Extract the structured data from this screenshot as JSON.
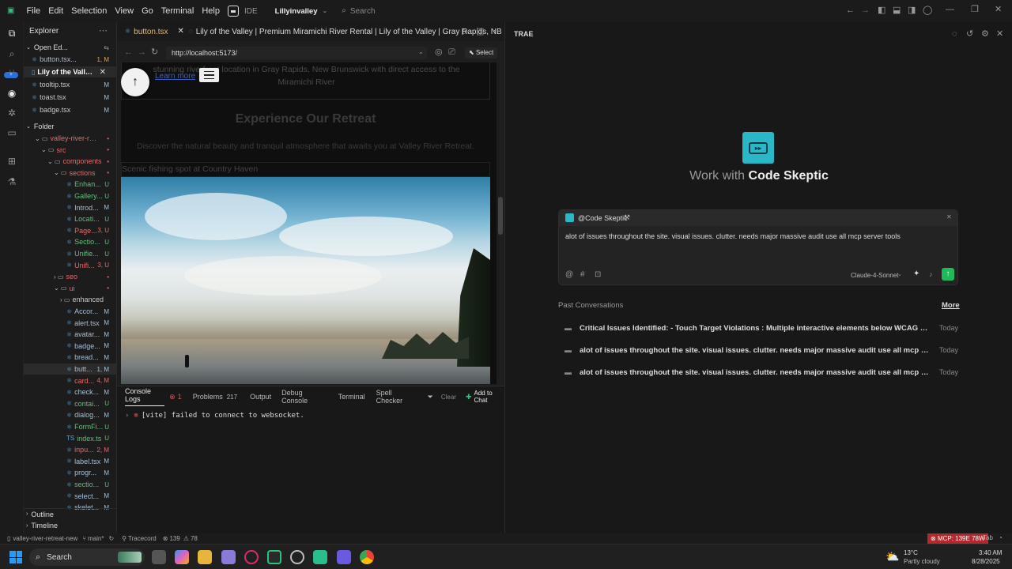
{
  "menu": [
    "File",
    "Edit",
    "Selection",
    "View",
    "Go",
    "Terminal",
    "Help"
  ],
  "ide_badge": "IDE",
  "workspace": "Lillyinvalley",
  "search_placeholder": "Search",
  "explorer": {
    "title": "Explorer",
    "open_editors_label": "Open Ed...",
    "open_editors": [
      {
        "name": "button.tsx...",
        "status": "1, M"
      },
      {
        "name": "Lily of the Valley...",
        "status": ""
      },
      {
        "name": "tooltip.tsx",
        "status": "M"
      },
      {
        "name": "toast.tsx",
        "status": "M"
      },
      {
        "name": "badge.tsx",
        "status": "M"
      }
    ],
    "folder_label": "Folder",
    "tree": [
      {
        "name": "valley-river-retr...",
        "status": "•"
      },
      {
        "name": "src",
        "status": "•"
      },
      {
        "name": "components",
        "status": "•"
      },
      {
        "name": "sections",
        "status": "•"
      },
      {
        "name": "Enhan...",
        "status": "U"
      },
      {
        "name": "Gallery...",
        "status": "U"
      },
      {
        "name": "Introd...",
        "status": "M"
      },
      {
        "name": "Locati...",
        "status": "U"
      },
      {
        "name": "Page...",
        "status": "3, U"
      },
      {
        "name": "Sectio...",
        "status": "U"
      },
      {
        "name": "Unifie...",
        "status": "U"
      },
      {
        "name": "Unifi...",
        "status": "3, U"
      },
      {
        "name": "seo",
        "status": "•"
      },
      {
        "name": "ui",
        "status": "•"
      },
      {
        "name": "enhanced",
        "status": ""
      },
      {
        "name": "Accor...",
        "status": "M"
      },
      {
        "name": "alert.tsx",
        "status": "M"
      },
      {
        "name": "avatar...",
        "status": "M"
      },
      {
        "name": "badge...",
        "status": "M"
      },
      {
        "name": "bread...",
        "status": "M"
      },
      {
        "name": "butt...",
        "status": "1, M"
      },
      {
        "name": "card...",
        "status": "4, M"
      },
      {
        "name": "check...",
        "status": "M"
      },
      {
        "name": "contai...",
        "status": "U"
      },
      {
        "name": "dialog...",
        "status": "M"
      },
      {
        "name": "FormFi...",
        "status": "U"
      },
      {
        "name": "index.ts",
        "status": "U"
      },
      {
        "name": "inpu...",
        "status": "2, M"
      },
      {
        "name": "label.tsx",
        "status": "M"
      },
      {
        "name": "progr...",
        "status": "M"
      },
      {
        "name": "sectio...",
        "status": "U"
      },
      {
        "name": "select...",
        "status": "M"
      },
      {
        "name": "skelet...",
        "status": "M"
      }
    ],
    "outline": "Outline",
    "timeline": "Timeline"
  },
  "editor": {
    "tab1": "button.tsx",
    "tab2": "Lily of the Valley | Premium Miramichi River Rental | Lily of the Valley | Gray Rapids, NB",
    "url": "http://localhost:5173/",
    "select_label": "Select"
  },
  "preview": {
    "intro_line1": "stunning riverfront location in Gray Rapids, New Brunswick with direct access to the",
    "intro_line2": "Miramichi River",
    "link_text": "Learn more",
    "heading": "Experience Our Retreat",
    "subheading": "Discover the natural beauty and tranquil atmosphere that awaits you at Valley River Retreat.",
    "img_alt": "Scenic fishing spot at Country Haven"
  },
  "panel": {
    "tabs": [
      "Console Logs",
      "Problems",
      "Output",
      "Debug Console",
      "Terminal",
      "Spell Checker"
    ],
    "console_count": "1",
    "problems_count": "217",
    "clear": "Clear",
    "add_to_chat": "Add to Chat",
    "log": "[vite] failed to connect to websocket."
  },
  "trae": {
    "title": "TRAE",
    "hero_prefix": "Work with",
    "hero_name": "Code Skeptic",
    "agent": "@Code Skeptic",
    "input_text": "alot of issues throughout the site. visual issues. clutter. needs major massive audit use all mcp server tools",
    "model": "Claude-4-Sonnet",
    "past_label": "Past Conversations",
    "more": "More",
    "conversations": [
      {
        "title": "Critical Issues Identified: - Touch Target Violations : Multiple interactive elements below WCAG 2.1's 44x44px m...",
        "date": "Today"
      },
      {
        "title": "alot of issues throughout the site. visual issues. clutter. needs major massive audit use all mcp server tools",
        "date": "Today"
      },
      {
        "title": "alot of issues throughout the site. visual issues. clutter. needs major massive audit use all mcp server tools",
        "date": "Today"
      }
    ]
  },
  "statusbar": {
    "repo": "valley-river-retreat-new",
    "branch": "main*",
    "tracecord": "Tracecord",
    "errors": "139",
    "warnings": "78",
    "mcp": "MCP: 139E 78W",
    "tab": "Tab"
  },
  "taskbar": {
    "search": "Search",
    "temp": "13°C",
    "weather": "Partly cloudy",
    "time": "3:40 AM",
    "date": "8/28/2025"
  },
  "colors": {
    "accent": "#1fb95a",
    "teal": "#2ab7c8",
    "error": "#e05252",
    "mcp_bg": "#b3282d"
  }
}
